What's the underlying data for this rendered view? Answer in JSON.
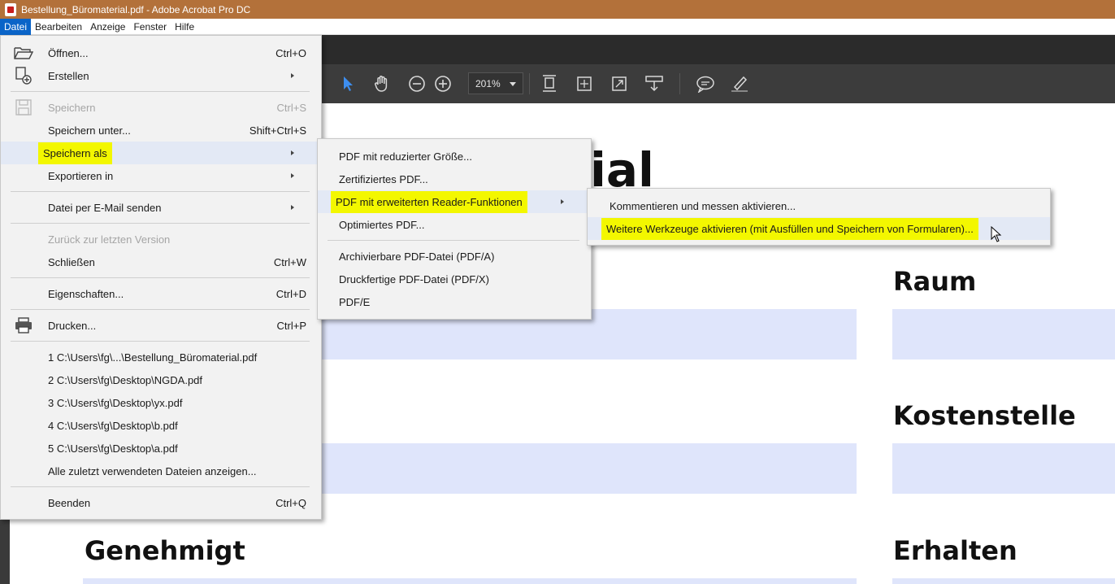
{
  "window": {
    "title": "Bestellung_Büromaterial.pdf - Adobe Acrobat Pro DC"
  },
  "menubar": {
    "items": [
      "Datei",
      "Bearbeiten",
      "Anzeige",
      "Fenster",
      "Hilfe"
    ]
  },
  "toolbar": {
    "zoom": "201%",
    "icons": [
      "select-arrow-icon",
      "hand-icon",
      "zoom-out-icon",
      "zoom-in-icon",
      "fit-page-icon",
      "fit-width-icon",
      "full-screen-icon",
      "scroll-mode-icon",
      "comment-icon",
      "highlight-icon"
    ]
  },
  "file_menu": {
    "items": [
      {
        "label": "Öffnen...",
        "shortcut": "Ctrl+O"
      },
      {
        "label": "Erstellen",
        "shortcut": ""
      },
      {
        "label": "Speichern",
        "shortcut": "Ctrl+S"
      },
      {
        "label": "Speichern unter...",
        "shortcut": "Shift+Ctrl+S"
      },
      {
        "label": "Speichern als",
        "shortcut": ""
      },
      {
        "label": "Exportieren in",
        "shortcut": ""
      },
      {
        "label": "Datei per E-Mail senden",
        "shortcut": ""
      },
      {
        "label": "Zurück zur letzten Version",
        "shortcut": ""
      },
      {
        "label": "Schließen",
        "shortcut": "Ctrl+W"
      },
      {
        "label": "Eigenschaften...",
        "shortcut": "Ctrl+D"
      },
      {
        "label": "Drucken...",
        "shortcut": "Ctrl+P"
      },
      {
        "label": "1 C:\\Users\\fg\\...\\Bestellung_Büromaterial.pdf",
        "shortcut": ""
      },
      {
        "label": "2 C:\\Users\\fg\\Desktop\\NGDA.pdf",
        "shortcut": ""
      },
      {
        "label": "3 C:\\Users\\fg\\Desktop\\yx.pdf",
        "shortcut": ""
      },
      {
        "label": "4 C:\\Users\\fg\\Desktop\\b.pdf",
        "shortcut": ""
      },
      {
        "label": "5 C:\\Users\\fg\\Desktop\\a.pdf",
        "shortcut": ""
      },
      {
        "label": "Alle zuletzt verwendeten Dateien anzeigen...",
        "shortcut": ""
      },
      {
        "label": "Beenden",
        "shortcut": "Ctrl+Q"
      }
    ]
  },
  "save_as_menu": {
    "items": [
      "PDF mit reduzierter Größe...",
      "Zertifiziertes PDF...",
      "PDF mit erweiterten Reader-Funktionen",
      "Optimiertes PDF...",
      "Archivierbare PDF-Datei (PDF/A)",
      "Druckfertige PDF-Datei (PDF/X)",
      "PDF/E"
    ]
  },
  "reader_menu": {
    "items": [
      "Kommentieren und messen aktivieren...",
      "Weitere Werkzeuge aktivieren (mit Ausfüllen und Speichern von Formularen)..."
    ]
  },
  "document": {
    "title_fragment": "ial",
    "labels": [
      "Raum",
      "Kostenstelle",
      "Genehmigt",
      "Erhalten"
    ]
  },
  "colors": {
    "titlebar": "#b3713a",
    "highlight": "#f3f700",
    "field": "#dfe5fb",
    "menubar_active": "#0a64c8"
  }
}
